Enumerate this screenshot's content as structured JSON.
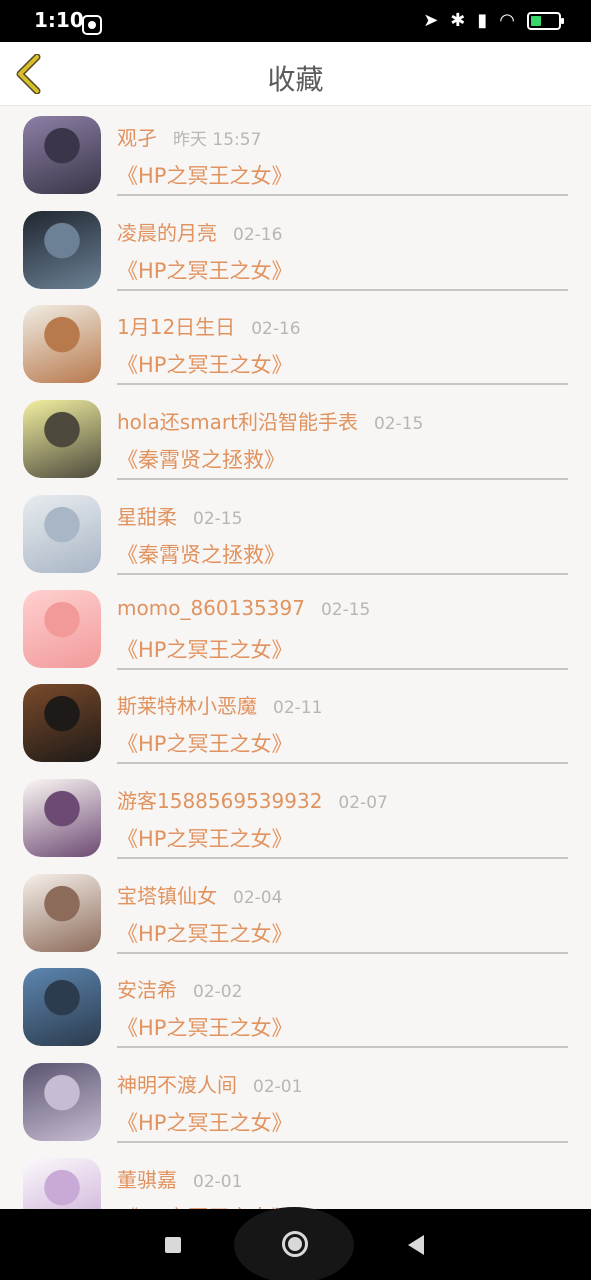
{
  "status_bar": {
    "time": "1:10",
    "icons": [
      "location-icon",
      "bluetooth-icon",
      "signal-icon",
      "wifi-icon",
      "battery-icon"
    ]
  },
  "header": {
    "title": "收藏",
    "back_icon": "chevron-left-icon",
    "back_color": "#d7c12a"
  },
  "colors": {
    "accent": "#e0935f",
    "time_gray": "#b8b6b4",
    "divider": "#c8c6c4"
  },
  "favorites": [
    {
      "name": "观孑",
      "time": "昨天 15:57",
      "book": "《HP之冥王之女》",
      "avatar_colors": [
        "#8d7fa6",
        "#3a3548"
      ]
    },
    {
      "name": "凌晨的月亮",
      "time": "02-16",
      "book": "《HP之冥王之女》",
      "avatar_colors": [
        "#1f2630",
        "#6c8195"
      ]
    },
    {
      "name": "1月12日生日",
      "time": "02-16",
      "book": "《HP之冥王之女》",
      "avatar_colors": [
        "#f0ede4",
        "#b8794d"
      ]
    },
    {
      "name": "hola还smart利沿智能手表",
      "time": "02-15",
      "book": "《秦霄贤之拯救》",
      "avatar_colors": [
        "#f2f0a0",
        "#4d4a3d"
      ]
    },
    {
      "name": "星甜柔",
      "time": "02-15",
      "book": "《秦霄贤之拯救》",
      "avatar_colors": [
        "#e8ecef",
        "#a9b6c6"
      ]
    },
    {
      "name": "momo_860135397",
      "time": "02-15",
      "book": "《HP之冥王之女》",
      "avatar_colors": [
        "#ffd0d0",
        "#f29a9a"
      ]
    },
    {
      "name": "斯莱特林小恶魔",
      "time": "02-11",
      "book": "《HP之冥王之女》",
      "avatar_colors": [
        "#7a4a2a",
        "#1e1a18"
      ]
    },
    {
      "name": "游客1588569539932",
      "time": "02-07",
      "book": "《HP之冥王之女》",
      "avatar_colors": [
        "#fbf7f5",
        "#6d4a73"
      ]
    },
    {
      "name": "宝塔镇仙女",
      "time": "02-04",
      "book": "《HP之冥王之女》",
      "avatar_colors": [
        "#f6f0ea",
        "#8c6b5a"
      ]
    },
    {
      "name": "安洁希",
      "time": "02-02",
      "book": "《HP之冥王之女》",
      "avatar_colors": [
        "#5d86b0",
        "#2c3b4d"
      ]
    },
    {
      "name": "神明不渡人间",
      "time": "02-01",
      "book": "《HP之冥王之女》",
      "avatar_colors": [
        "#5b5470",
        "#c7bdd2"
      ]
    },
    {
      "name": "董骐嘉",
      "time": "02-01",
      "book": "《HP之冥王之女》",
      "avatar_colors": [
        "#fbf9fb",
        "#c9a9d6"
      ]
    }
  ],
  "nav_bar": {
    "icons": [
      "recent-apps-icon",
      "home-icon",
      "back-triangle-icon"
    ]
  }
}
